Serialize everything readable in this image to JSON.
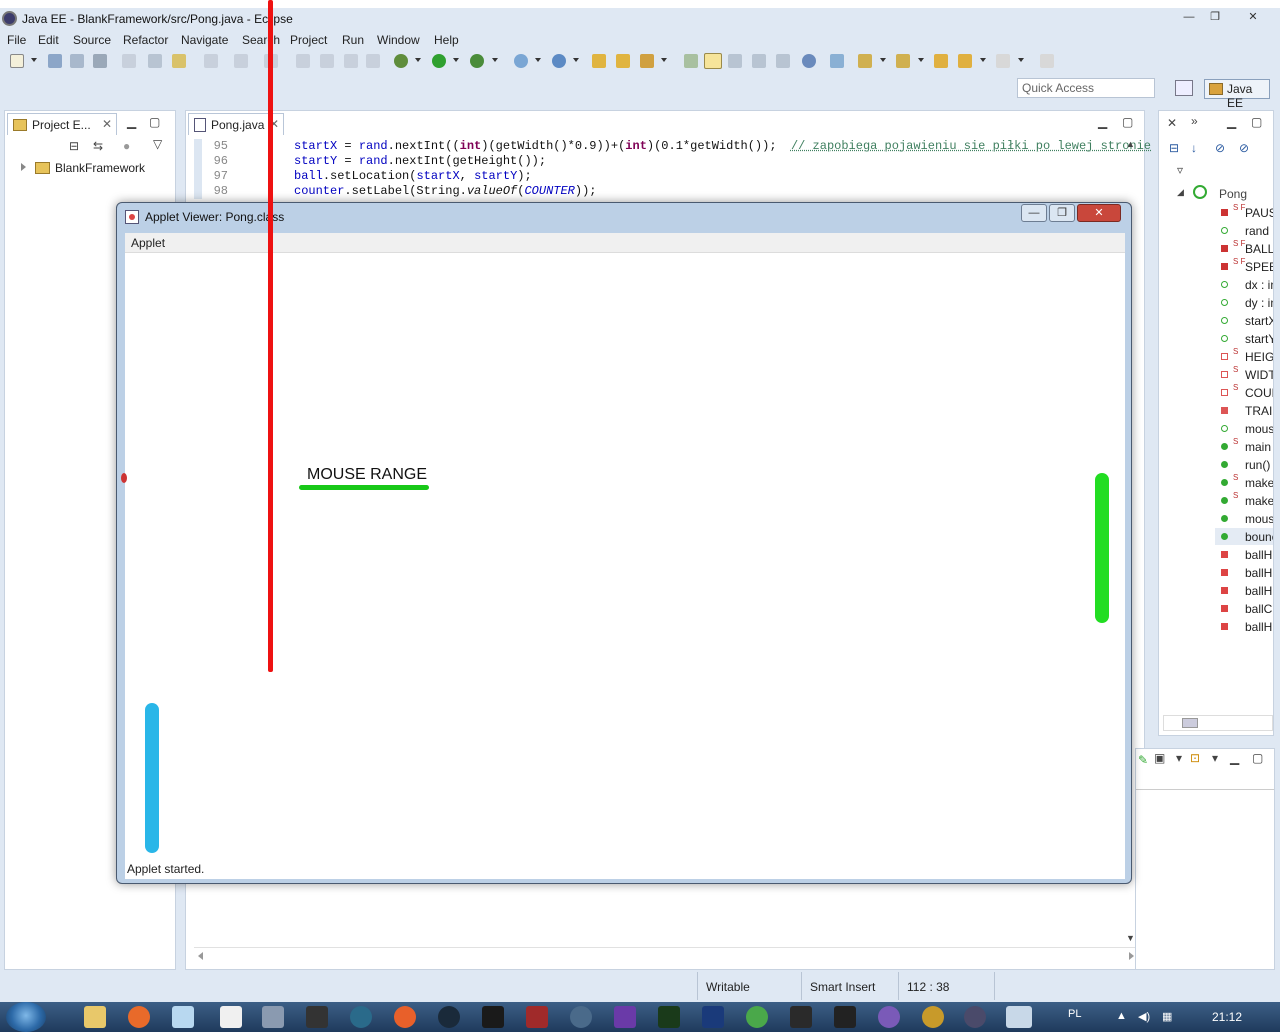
{
  "window": {
    "title": "Java EE - BlankFramework/src/Pong.java - Eclipse",
    "controls": [
      "—",
      "❐",
      "✕"
    ]
  },
  "menu": [
    "File",
    "Edit",
    "Source",
    "Refactor",
    "Navigate",
    "Search",
    "Project",
    "Run",
    "Window",
    "Help"
  ],
  "quick_access": {
    "placeholder": "Quick Access"
  },
  "perspective": {
    "label": "Java EE"
  },
  "project_explorer": {
    "tab_label": "Project E...",
    "tree": [
      {
        "label": "BlankFramework"
      }
    ]
  },
  "editor": {
    "tab_label": "Pong.java",
    "lines": [
      {
        "num": "95",
        "parts": [
          [
            "fld",
            "startX"
          ],
          [
            "t",
            " = "
          ],
          [
            "fld",
            "rand"
          ],
          [
            "t",
            ".nextInt(("
          ],
          [
            "kw",
            "int"
          ],
          [
            "t",
            ")(getWidth()*0.9))+("
          ],
          [
            "kw",
            "int"
          ],
          [
            "t",
            ")(0.1*getWidth());  "
          ],
          [
            "cmt",
            "// zapobiega pojawieniu sie piłki po lewej stronie"
          ]
        ]
      },
      {
        "num": "96",
        "parts": [
          [
            "fld",
            "startY"
          ],
          [
            "t",
            " = "
          ],
          [
            "fld",
            "rand"
          ],
          [
            "t",
            ".nextInt(getHeight());"
          ]
        ]
      },
      {
        "num": "97",
        "parts": [
          [
            "fld",
            "ball"
          ],
          [
            "t",
            ".setLocation("
          ],
          [
            "fld",
            "startX"
          ],
          [
            "t",
            ", "
          ],
          [
            "fld",
            "startY"
          ],
          [
            "t",
            ");"
          ]
        ]
      },
      {
        "num": "98",
        "parts": [
          [
            "fld",
            "counter"
          ],
          [
            "t",
            ".setLabel(String."
          ],
          [
            "ital",
            "valueOf"
          ],
          [
            "t",
            "("
          ],
          [
            "cst",
            "COUNTER"
          ],
          [
            "t",
            "));"
          ]
        ]
      }
    ]
  },
  "outline": {
    "root": "Pong",
    "items": [
      {
        "label": "PAUSE",
        "kind": "sf",
        "color": "#c33"
      },
      {
        "label": "rand",
        "kind": "f",
        "color": "#3a3"
      },
      {
        "label": "BALL",
        "kind": "sf",
        "color": "#c33"
      },
      {
        "label": "SPEED",
        "kind": "sf",
        "color": "#c33"
      },
      {
        "label": "dx : int",
        "kind": "f",
        "color": "#3a3"
      },
      {
        "label": "dy : int",
        "kind": "f",
        "color": "#3a3"
      },
      {
        "label": "startX",
        "kind": "f",
        "color": "#3a3"
      },
      {
        "label": "startY",
        "kind": "f",
        "color": "#3a3"
      },
      {
        "label": "HEIGHT",
        "kind": "s",
        "color": "#d55"
      },
      {
        "label": "WIDTH",
        "kind": "s",
        "color": "#d55"
      },
      {
        "label": "COUNTER",
        "kind": "s",
        "color": "#d55"
      },
      {
        "label": "TRAIL",
        "kind": "p",
        "color": "#d55"
      },
      {
        "label": "mouse",
        "kind": "f",
        "color": "#3a3"
      },
      {
        "label": "main",
        "kind": "sm",
        "color": "#3a3"
      },
      {
        "label": "run()",
        "kind": "m",
        "color": "#3a3"
      },
      {
        "label": "make",
        "kind": "sm",
        "color": "#3a3"
      },
      {
        "label": "make",
        "kind": "sm",
        "color": "#3a3"
      },
      {
        "label": "mouse",
        "kind": "m",
        "color": "#3a3"
      },
      {
        "label": "bounce",
        "kind": "m",
        "color": "#3a3",
        "selected": true
      },
      {
        "label": "ballH",
        "kind": "p",
        "color": "#d44"
      },
      {
        "label": "ballH",
        "kind": "p",
        "color": "#d44"
      },
      {
        "label": "ballH",
        "kind": "p",
        "color": "#d44"
      },
      {
        "label": "ballC",
        "kind": "p",
        "color": "#d44"
      },
      {
        "label": "ballH",
        "kind": "p",
        "color": "#d44"
      }
    ]
  },
  "status": {
    "writable": "Writable",
    "insert": "Smart Insert",
    "position": "112 : 38"
  },
  "applet": {
    "title": "Applet Viewer: Pong.class",
    "menu": "Applet",
    "label": "MOUSE RANGE",
    "status": "Applet started."
  },
  "colors": {
    "red_line": "#ee1111",
    "label_underline": "#18c818",
    "right_paddle": "#22dd22",
    "left_paddle": "#29b6e8"
  },
  "taskbar": {
    "lang": "PL",
    "time": "21:12"
  }
}
